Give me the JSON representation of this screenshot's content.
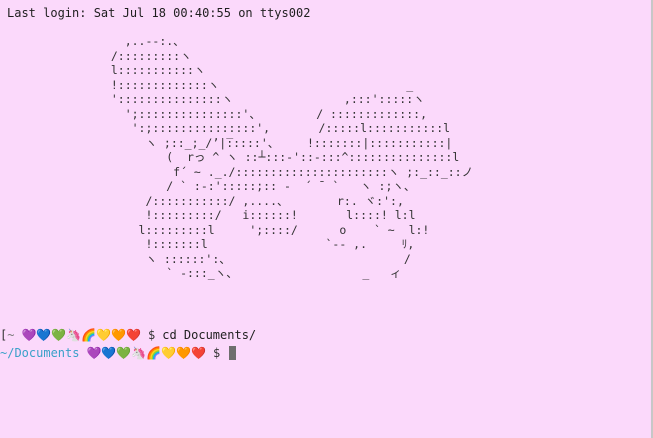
{
  "terminal": {
    "login_text": "Last login: Sat Jul 18 00:40:55 on ttys002",
    "ascii_art": "                 ,..--:.、\n               /:::::::::ヽ\n               l:::::::::::ヽ\n               !:::::::::::::ヽ                           _\n               ':::::::::::::::ヽ                ,:::':::::ヽ\n                 ';:::::::::::::::'、        / :::::::::::::,\n                  ':;:::::::::::::::',       /:::::l:::::::::::l\n                    ヽ ;::_;_/ʼ|̅:::::'、    !:::::::|:::::::::::|\n                       (  rっ ^ ヽ ::┴:::-'::-:::^:::::::::::::::l\n                        f´ ~ ._./::::::::::::::::::::::ヽ ;:_::_::ノ\n                       / ` :-:':::::;:: -  ´ ¯ `   ヽ :;ヽ、\n                    /:::::::::::/ ,....、       r:. ヾ:':,\n                    !:::::::::/   i::::::!       l::::! l:l\n                   l:::::::::l     ';::::/      o    ` ~  l:!\n                    !:::::::l                 `-- ,.     ﾘ,\n                    ヽ ::::::':、                         /\n                       ` -:::_ヽ、                  _   ィ",
    "prompt1": {
      "bracket": "[",
      "tilde": "~",
      "emojis": "💜💙💚🦄🌈💛🧡❤️",
      "dollar": "$",
      "command": "cd Documents/"
    },
    "prompt2": {
      "cwd": "~/Documents",
      "emojis": "💜💙💚🦄🌈💛🧡❤️",
      "dollar": "$"
    },
    "colors": {
      "background": "#fbd9fb",
      "cwd": "#3aa0c9",
      "cursor": "#6e6e6e"
    }
  }
}
